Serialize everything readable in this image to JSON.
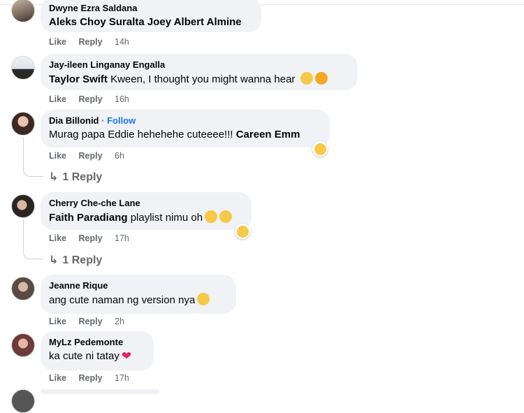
{
  "comments": [
    {
      "author": "Dwyne Ezra Saldana",
      "text_parts": [
        "Aleks Choy Suralta",
        " ",
        "Joey Albert Almine"
      ],
      "like": "Like",
      "reply": "Reply",
      "time": "14h"
    },
    {
      "author": "Jay-ileen Linganay Engalla",
      "mention": "Taylor Swift",
      "text": " Kween, I thought you might wanna hear",
      "emojis": [
        "grinning-face",
        "smiling-face-with-hearts"
      ],
      "like": "Like",
      "reply": "Reply",
      "time": "16h"
    },
    {
      "author": "Dia Billonid",
      "dot": "·",
      "follow": "Follow",
      "text": "Murag papa Eddie hehehehe cuteeee!!! ",
      "mention": "Careen Emm",
      "reaction": "zany-face",
      "like": "Like",
      "reply": "Reply",
      "time": "6h",
      "replies": "1 Reply"
    },
    {
      "author": "Cherry Che-che Lane",
      "mention": "Faith Paradiang",
      "text": " playlist nimu oh",
      "emojis": [
        "rolling-on-floor-laughing",
        "grinning-sweat"
      ],
      "reaction": "laughing-face",
      "like": "Like",
      "reply": "Reply",
      "time": "17h",
      "replies": "1 Reply"
    },
    {
      "author": "Jeanne Rique",
      "text": "ang cute naman ng version nya",
      "emojis": [
        "face-with-hand-over-mouth"
      ],
      "like": "Like",
      "reply": "Reply",
      "time": "2h"
    },
    {
      "author": "MyLz Pedemonte",
      "text": "ka cute ni tatay",
      "emojis": [
        "red-heart"
      ],
      "like": "Like",
      "reply": "Reply",
      "time": "17h"
    }
  ]
}
